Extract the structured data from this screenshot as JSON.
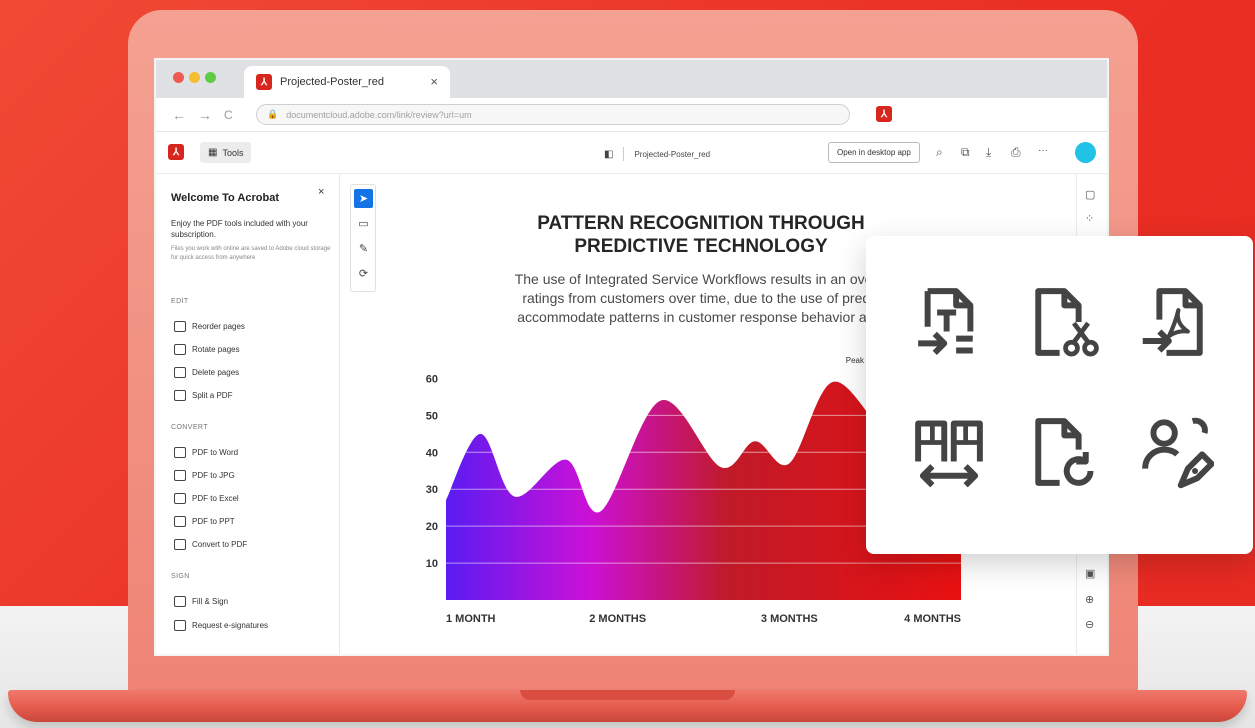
{
  "browser": {
    "tab_title": "Projected-Poster_red",
    "tab_close": "×",
    "url": "documentcloud.adobe.com/link/review?url=um",
    "back": "←",
    "forward": "→",
    "reload": "C"
  },
  "toolbar": {
    "tools_label": "Tools",
    "doc_title": "Projected-Poster_red",
    "open_desktop_label": "Open in desktop app",
    "more": "···"
  },
  "left_panel": {
    "title": "Welcome To Acrobat",
    "close": "×",
    "description": "Enjoy the PDF tools included with your subscription.",
    "note": "Files you work with online are saved to Adobe cloud storage for quick access from anywhere",
    "sections": {
      "edit": "EDIT",
      "convert": "CONVERT",
      "sign": "SIGN"
    },
    "edit_items": [
      "Reorder pages",
      "Rotate pages",
      "Delete pages",
      "Split a PDF"
    ],
    "convert_items": [
      "PDF to Word",
      "PDF to JPG",
      "PDF to Excel",
      "PDF to PPT",
      "Convert to PDF"
    ],
    "sign_items": [
      "Fill & Sign",
      "Request e-signatures"
    ]
  },
  "document": {
    "heading_line1": "PATTERN RECOGNITION THROUGH",
    "heading_line2": "PREDICTIVE TECHNOLOGY",
    "body_line1": "The use of Integrated Service Workflows results in an overall incre",
    "body_line2": "ratings from customers over time, due to the use of predictive te",
    "body_line3": "accommodate patterns in customer response behavior as depicte"
  },
  "chart_data": {
    "type": "area",
    "x_labels": [
      "1 MONTH",
      "2 MONTHS",
      "3 MONTHS",
      "4 MONTHS"
    ],
    "y_ticks": [
      10,
      20,
      30,
      40,
      50,
      60
    ],
    "ylim": [
      0,
      65
    ],
    "xlim": [
      1,
      4
    ],
    "x": [
      1.0,
      1.2,
      1.4,
      1.7,
      1.9,
      2.25,
      2.6,
      2.8,
      3.0,
      3.25,
      3.55,
      3.8,
      4.0
    ],
    "values": [
      27,
      45,
      28,
      38,
      24,
      54,
      36,
      43,
      37,
      59,
      46,
      42,
      40
    ],
    "annotation": "Peak Optimizat",
    "annotation_x": 3.55,
    "annotation_y": 61,
    "colors": [
      "#5a1cf2",
      "#cc10d6",
      "#c01a28",
      "#e81111"
    ]
  },
  "overlay_icons": [
    "convert-to-text-icon",
    "cut-document-icon",
    "pdf-export-icon",
    "reorder-pages-icon",
    "rotate-document-icon",
    "request-signature-icon"
  ],
  "brand_color": "#d7261e",
  "accent_color": "#1473e6"
}
